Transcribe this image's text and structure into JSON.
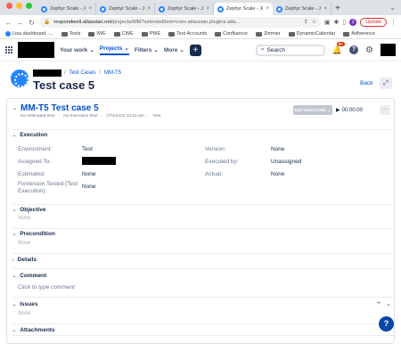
{
  "browser": {
    "tabs": [
      {
        "label": "Zephyr Scale - Jira"
      },
      {
        "label": "Zephyr Scale - Jira"
      },
      {
        "label": "Zephyr Scale - Jira"
      },
      {
        "label": "Zephyr Scale - Jira",
        "active": true
      },
      {
        "label": "Zephyr Scale - Jira"
      }
    ],
    "url_host": "respondwell.atlassian.net",
    "url_path": "/projects/MM?selectedItem=com.atlassian.plugins.atla...",
    "profile_initial": "Z",
    "update_label": "Update"
  },
  "bookmarks": [
    {
      "label": "Lisa dashboard -..."
    },
    {
      "label": "Tools"
    },
    {
      "label": "IWE"
    },
    {
      "label": "CWE"
    },
    {
      "label": "PWE"
    },
    {
      "label": "Test Accounts"
    },
    {
      "label": "Confluence"
    },
    {
      "label": "Zimmer"
    },
    {
      "label": "DynamicCalendar"
    },
    {
      "label": "Adherence"
    }
  ],
  "jira_nav": {
    "your_work": "Your work",
    "projects": "Projects",
    "filters": "Filters",
    "more": "More",
    "create": "+",
    "search_placeholder": "Search",
    "notifications_badge": "9+"
  },
  "header": {
    "breadcrumb_test_cases": "Test Cases",
    "breadcrumb_key": "MM-T5",
    "title": "Test case 5",
    "back": "Back"
  },
  "test_case": {
    "title": "MM-T5 Test case 5",
    "meta_estimated": "No estimated time",
    "meta_execution": "No execution time",
    "meta_date": "27/Jun/22 10:16 am",
    "meta_label": "Test",
    "status": "NOT EXECUTED",
    "timer": "00:00:00"
  },
  "execution": {
    "heading": "Execution",
    "environment_label": "Environment:",
    "environment_value": "Test",
    "assigned_label": "Assigned To:",
    "estimated_label": "Estimated:",
    "estimated_value": "None",
    "fixversion_label": "FixVersion Tested (Test Execution):",
    "fixversion_value": "None",
    "version_label": "Version:",
    "version_value": "None",
    "executed_by_label": "Executed by:",
    "executed_by_value": "Unassigned",
    "actual_label": "Actual:",
    "actual_value": "None"
  },
  "sections": {
    "objective": "Objective",
    "objective_value": "None",
    "precondition": "Precondition",
    "precondition_value": "None",
    "details": "Details",
    "comment": "Comment",
    "comment_hint": "Click to type comment",
    "issues": "Issues",
    "issues_value": "None",
    "attachments": "Attachments"
  },
  "colors": {
    "accent": "#0052cc",
    "text": "#172b4d",
    "muted": "#6b778c"
  }
}
